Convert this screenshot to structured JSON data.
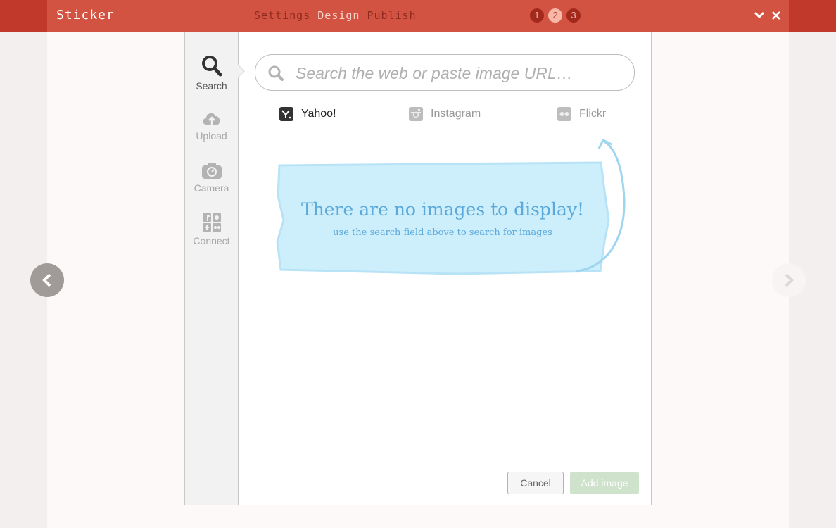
{
  "app": {
    "title": "Sticker"
  },
  "steps": {
    "settings": "Settings",
    "design": "Design",
    "publish": "Publish"
  },
  "badges": [
    "1",
    "2",
    "3"
  ],
  "window": {
    "collapse_icon": "chevron-down-icon",
    "close_icon": "close-icon"
  },
  "sidebar": {
    "items": [
      {
        "label": "Search",
        "icon": "search-icon",
        "active": true
      },
      {
        "label": "Upload",
        "icon": "cloud-upload-icon",
        "active": false
      },
      {
        "label": "Camera",
        "icon": "camera-icon",
        "active": false
      },
      {
        "label": "Connect",
        "icon": "social-grid-icon",
        "active": false
      }
    ]
  },
  "search": {
    "placeholder": "Search the web or paste image URL…",
    "value": ""
  },
  "sources": [
    {
      "label": "Yahoo!",
      "icon": "yahoo-icon",
      "active": true
    },
    {
      "label": "Instagram",
      "icon": "instagram-icon",
      "active": false
    },
    {
      "label": "Flickr",
      "icon": "flickr-icon",
      "active": false
    }
  ],
  "empty_state": {
    "title": "There are no images to display!",
    "subtitle": "use the search field above to search for images"
  },
  "footer": {
    "cancel_label": "Cancel",
    "add_label": "Add image"
  },
  "colors": {
    "header": "#d35342",
    "accent_blue": "#5aa9da",
    "add_button": "#cfe3cc"
  }
}
